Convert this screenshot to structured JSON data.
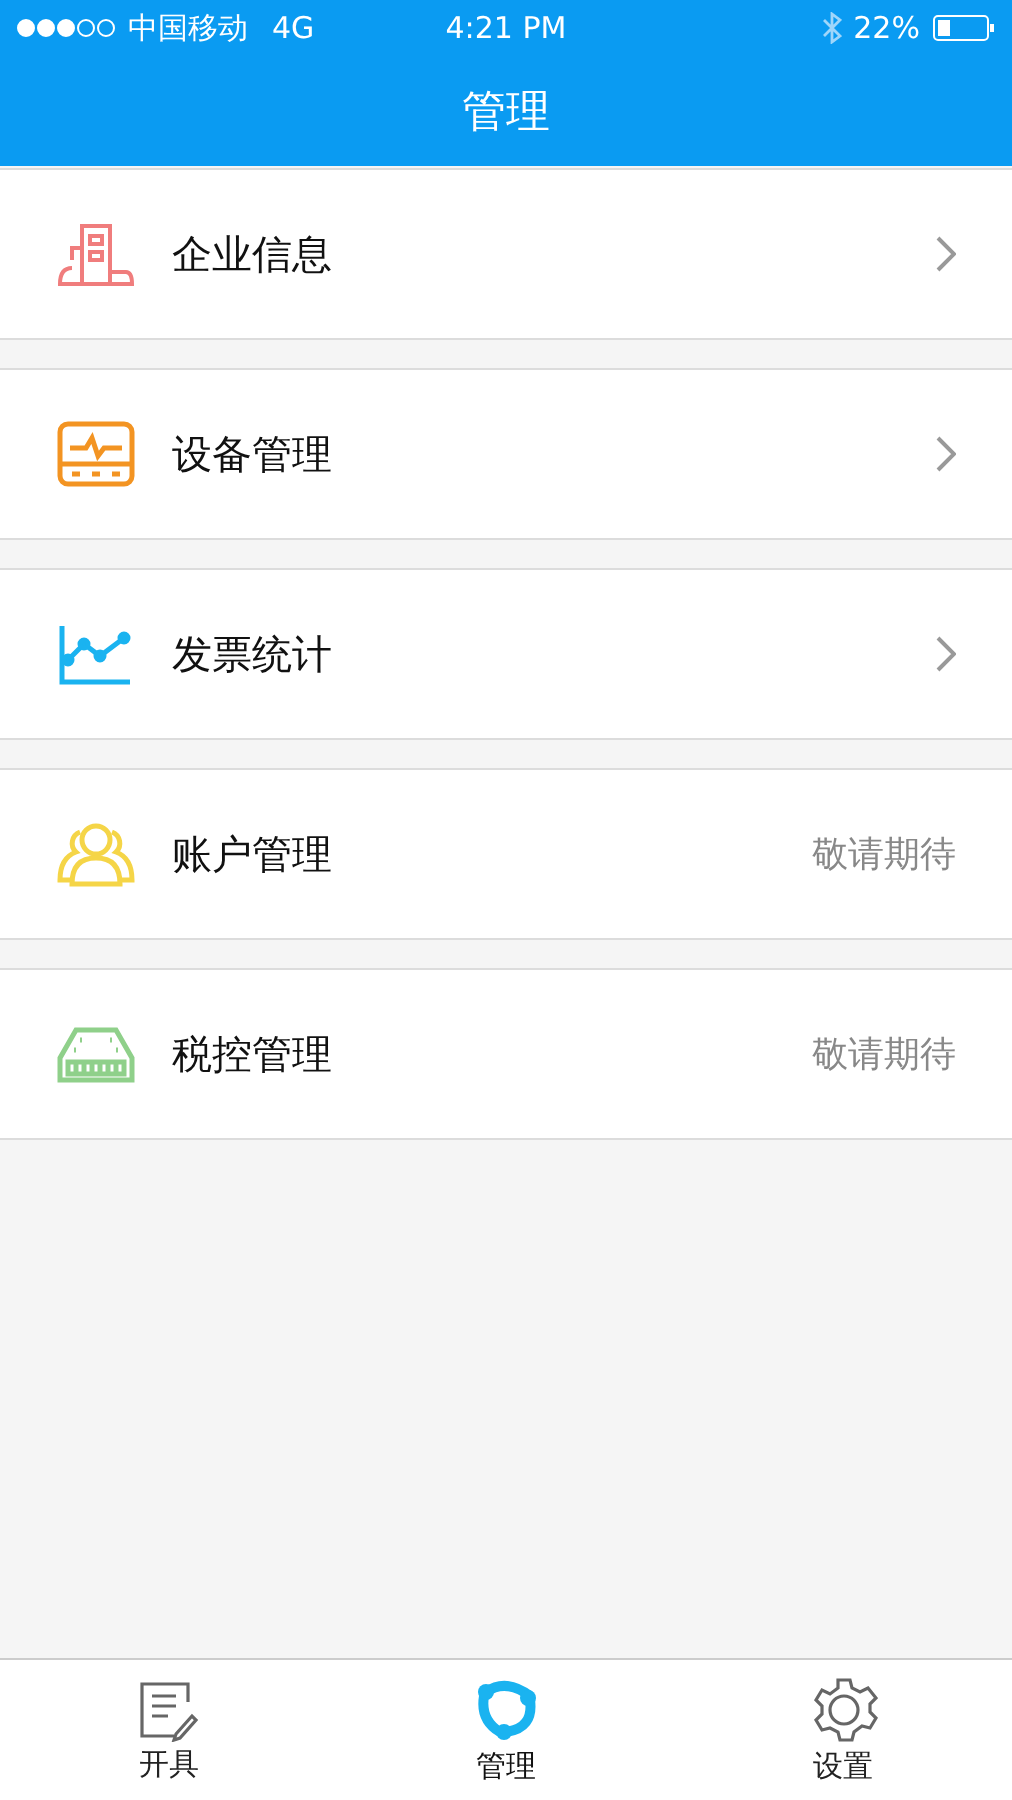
{
  "status_bar": {
    "carrier": "中国移动",
    "network": "4G",
    "time": "4:21 PM",
    "battery": "22%"
  },
  "nav": {
    "title": "管理"
  },
  "items": [
    {
      "label": "企业信息",
      "kind": "chevron"
    },
    {
      "label": "设备管理",
      "kind": "chevron"
    },
    {
      "label": "发票统计",
      "kind": "chevron"
    },
    {
      "label": "账户管理",
      "kind": "note",
      "note": "敬请期待"
    },
    {
      "label": "税控管理",
      "kind": "note",
      "note": "敬请期待"
    }
  ],
  "tabs": [
    {
      "label": "开具",
      "selected": false
    },
    {
      "label": "管理",
      "selected": true
    },
    {
      "label": "设置",
      "selected": false
    }
  ]
}
